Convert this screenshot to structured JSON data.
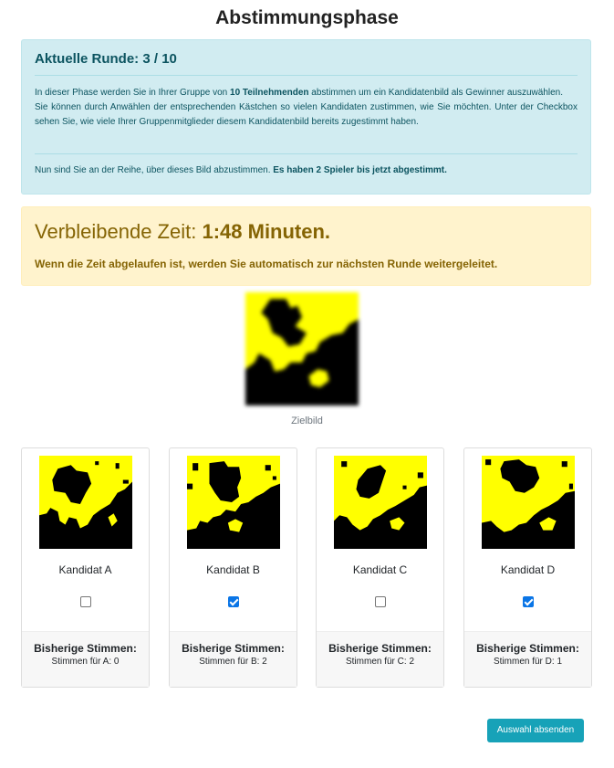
{
  "page": {
    "title": "Abstimmungsphase"
  },
  "info": {
    "heading": "Aktuelle Runde: 3 / 10",
    "p1_pre": "In dieser Phase werden Sie in Ihrer Gruppe von ",
    "p1_bold": "10 Teilnehmenden",
    "p1_post": " abstimmen um ein Kandidatenbild als Gewinner auszuwählen.",
    "p2": "Sie können durch Anwählen der entsprechenden Kästchen so vielen Kandidaten zustimmen, wie Sie möchten. Unter der Checkbox sehen Sie, wie viele Ihrer Gruppenmitglieder diesem Kandidatenbild bereits zugestimmt haben.",
    "p3_pre": "Nun sind Sie an der Reihe, über dieses Bild abzustimmen. ",
    "p3_bold": "Es haben 2 Spieler bis jetzt abgestimmt."
  },
  "timer": {
    "label": "Verbleibende Zeit: ",
    "value": "1:48 Minuten.",
    "note": "Wenn die Zeit abgelaufen ist, werden Sie automatisch zur nächsten Runde weitergeleitet."
  },
  "target": {
    "caption": "Zielbild"
  },
  "colors": {
    "yellow": "#ffff00",
    "black": "#000000",
    "accent": "#17a2b8"
  },
  "candidates": [
    {
      "name": "Kandidat A",
      "checked": false,
      "votes_heading": "Bisherige Stimmen:",
      "votes_text": "Stimmen für A: 0"
    },
    {
      "name": "Kandidat B",
      "checked": true,
      "votes_heading": "Bisherige Stimmen:",
      "votes_text": "Stimmen für B: 2"
    },
    {
      "name": "Kandidat C",
      "checked": false,
      "votes_heading": "Bisherige Stimmen:",
      "votes_text": "Stimmen für C: 2"
    },
    {
      "name": "Kandidat D",
      "checked": true,
      "votes_heading": "Bisherige Stimmen:",
      "votes_text": "Stimmen für D: 1"
    }
  ],
  "submit": {
    "label": "Auswahl absenden"
  }
}
